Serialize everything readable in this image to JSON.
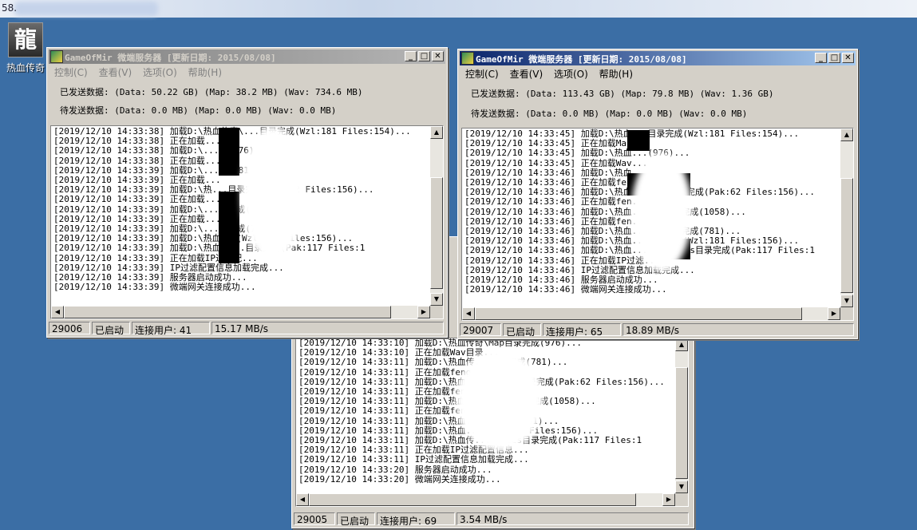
{
  "taskbar": {
    "text": "58."
  },
  "desktop_icon": {
    "glyph": "龍",
    "label": "热血传奇"
  },
  "windows": [
    {
      "title": "GameOfMir 微端服务器 [更新日期: 2015/08/08]",
      "menu": [
        "控制(C)",
        "查看(V)",
        "选项(O)",
        "帮助(H)"
      ],
      "sent": "已发送数据: (Data: 50.22 GB) (Map: 38.2 MB) (Wav: 734.6 MB)",
      "pending": "待发送数据: (Data: 0.0 MB) (Map: 0.0 MB) (Wav: 0.0 MB)",
      "logs": [
        "[2019/12/10 14:33:38] 加载D:\\热血传奇\\...目录完成(Wzl:181 Files:154)...",
        "[2019/12/10 14:33:38] 正在加载...",
        "[2019/12/10 14:33:38] 加载D:\\...成(976)...",
        "[2019/12/10 14:33:38] 正在加载...",
        "[2019/12/10 14:33:39] 加载D:\\...成(781)...",
        "[2019/12/10 14:33:39] 正在加载...",
        "[2019/12/10 14:33:39] 加载D:\\热...目录完成(Pak:62 Files:156)...",
        "[2019/12/10 14:33:39] 正在加载...",
        "[2019/12/10 14:33:39] 加载D:\\...录完成(1058)...",
        "[2019/12/10 14:33:39] 正在加载...",
        "[2019/12/10 14:33:39] 加载D:\\...录完成(781)...",
        "[2019/12/10 14:33:39] 加载D:\\热血...(Wzl:181 Files:156)...",
        "[2019/12/10 14:33:39] 加载D:\\热血传...目录完成(Pak:117 Files:1",
        "[2019/12/10 14:33:39] 正在加载IP过滤配...",
        "[2019/12/10 14:33:39] IP过滤配置信息加载完成...",
        "[2019/12/10 14:33:39] 服务器启动成功...",
        "[2019/12/10 14:33:39] 微端网关连接成功..."
      ],
      "status": {
        "port": "29006",
        "state": "已启动",
        "users": "连接用户: 41",
        "speed": "15.17 MB/s"
      }
    },
    {
      "title": "GameOfMir 微端服务器 [更新日期: 2015/08/08]",
      "menu": [
        "控制(C)",
        "查看(V)",
        "选项(O)",
        "帮助(H)"
      ],
      "sent": "已发送数据: (Data: 113.43 GB) (Map: 79.8 MB) (Wav: 1.36 GB)",
      "pending": "待发送数据: (Data: 0.0 MB) (Map: 0.0 MB) (Wav: 0.0 MB)",
      "logs": [
        "[2019/12/10 14:33:45] 加载D:\\热血...目录完成(Wzl:181 Files:154)...",
        "[2019/12/10 14:33:45] 正在加载Map...",
        "[2019/12/10 14:33:45] 加载D:\\热血...(976)...",
        "[2019/12/10 14:33:45] 正在加载Wav...",
        "[2019/12/10 14:33:46] 加载D:\\热血...(781)...",
        "[2019/12/10 14:33:46] 正在加载fen...",
        "[2019/12/10 14:33:46] 加载D:\\热血...Data目录完成(Pak:62 Files:156)...",
        "[2019/12/10 14:33:46] 正在加载fen...",
        "[2019/12/10 14:33:46] 加载D:\\热血...Map目录完成(1058)...",
        "[2019/12/10 14:33:46] 正在加载fen...",
        "[2019/12/10 14:33:46] 加载D:\\热血...Wav目录完成(781)...",
        "[2019/12/10 14:33:46] 加载D:\\热血...目录完成(Wzl:181 Files:156)...",
        "[2019/12/10 14:33:46] 加载D:\\热血...\\Graphics目录完成(Pak:117 Files:1",
        "[2019/12/10 14:33:46] 正在加载IP过滤...",
        "[2019/12/10 14:33:46] IP过滤配置信息加载完成...",
        "[2019/12/10 14:33:46] 服务器启动成功...",
        "[2019/12/10 14:33:46] 微端网关连接成功..."
      ],
      "status": {
        "port": "29007",
        "state": "已启动",
        "users": "连接用户: 65",
        "speed": "18.89 MB/s"
      }
    },
    {
      "logs": [
        "[2019/12/10 14:33:10] 加载D:\\热血传奇\\Map目录完成(976)...",
        "[2019/12/10 14:33:10] 正在加载Wav目录...",
        "[2019/12/10 14:33:11] 加载D:\\热血传...目录完成(781)...",
        "[2019/12/10 14:33:11] 正在加载feng...录...",
        "[2019/12/10 14:33:11] 加载D:\\热血...ou\\Data目录完成(Pak:62 Files:156)...",
        "[2019/12/10 14:33:11] 正在加载feng...录...",
        "[2019/12/10 14:33:11] 加载D:\\热血...ou\\Map目录完成(1058)...",
        "[2019/12/10 14:33:11] 正在加载fen...",
        "[2019/12/10 14:33:11] 加载D:\\热血...目录完成(781)...",
        "[2019/12/10 14:33:11] 加载D:\\热血...(Wzl:181 Files:156)...",
        "[2019/12/10 14:33:11] 加载D:\\热血传...aphics目录完成(Pak:117 Files:1",
        "[2019/12/10 14:33:11] 正在加载IP过滤配置信息...",
        "[2019/12/10 14:33:11] IP过滤配置信息加载完成...",
        "[2019/12/10 14:33:20] 服务器启动成功...",
        "[2019/12/10 14:33:20] 微端网关连接成功..."
      ],
      "status": {
        "port": "29005",
        "state": "已启动",
        "users": "连接用户: 69",
        "speed": "3.54 MB/s"
      }
    }
  ]
}
